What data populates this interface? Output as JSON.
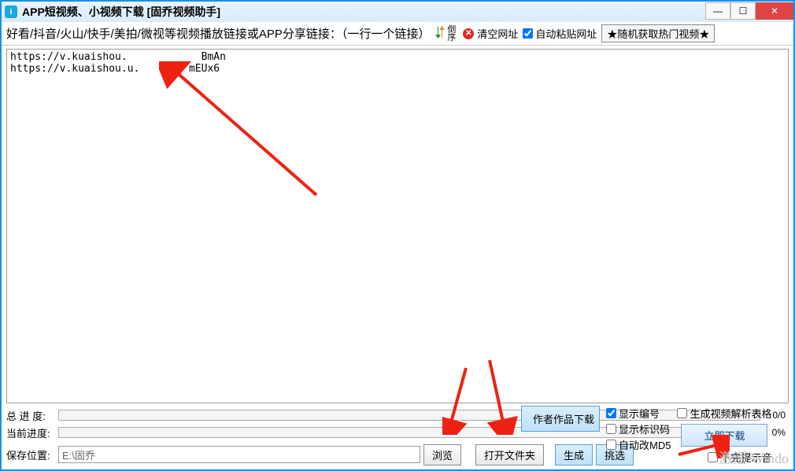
{
  "titlebar": {
    "title": "APP短视频、小视频下载 [固乔视频助手]"
  },
  "toolbar": {
    "instruction": "好看/抖音/火山/快手/美拍/微视等视频播放链接或APP分享链接：（一行一个链接）",
    "sort_label": "倒序",
    "clear_label": "清空网址",
    "autopaste_label": "自动粘贴网址",
    "random_label": "★随机获取热门视频★"
  },
  "urls_text": "https://v.kuaishou.            BmAn\nhttps://v.kuaishou.u.        mEUx6",
  "progress": {
    "total_label": "总 进 度:",
    "total_pct": "0/0",
    "current_label": "当前进度:",
    "current_pct": "0%"
  },
  "save": {
    "label": "保存位置:",
    "path": "E:\\固乔",
    "browse": "浏览",
    "openfolder": "打开文件夹"
  },
  "right": {
    "author_download": "作者作品下载",
    "generate": "生成",
    "filter": "挑选",
    "show_number": "显示编号",
    "show_id": "显示标识码",
    "auto_md5": "自动改MD5",
    "gen_table": "生成视频解析表格",
    "download_now": "立即下载",
    "done_sound": "下完提示音"
  },
  "checks": {
    "autopaste": true,
    "show_number": true,
    "show_id": false,
    "auto_md5": false,
    "gen_table": false,
    "done_sound": false
  },
  "watermark": {
    "line1": "激活 Windo"
  }
}
